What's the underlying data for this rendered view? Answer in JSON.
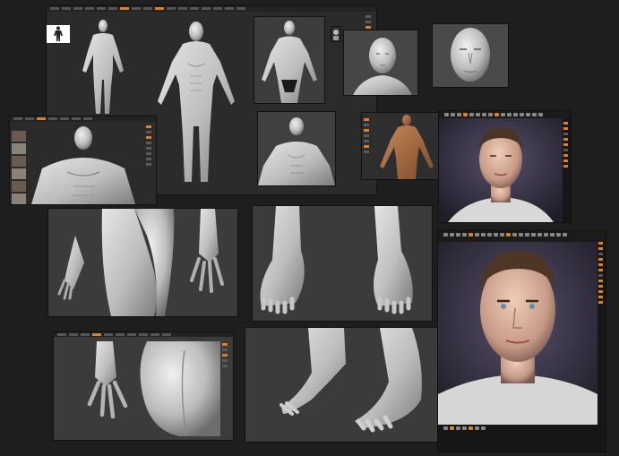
{
  "colors": {
    "background": "#1e1e1e",
    "viewport": "#3a3a3a",
    "ui_dark": "#232323",
    "accent": "#d8802a",
    "clay_light": "#d9d9d9",
    "clay_shadow": "#7a7a7a",
    "skin": "#c9a08a",
    "skin_bronze": "#a06a45"
  },
  "icons": {
    "figure_thumbnail": "human-silhouette-icon",
    "toolbar_buttons": "toolbar-button-icon",
    "side_tools": "tool-button-icon"
  },
  "panels": [
    {
      "name": "main-viewport-fullbody",
      "content": "sculpt"
    },
    {
      "name": "bust-closeup",
      "content": "sculpt"
    },
    {
      "name": "face-closeup",
      "content": "sculpt"
    },
    {
      "name": "torso-viewport",
      "content": "sculpt"
    },
    {
      "name": "bronze-figure",
      "content": "sculpt"
    },
    {
      "name": "render-face-1",
      "content": "render"
    },
    {
      "name": "render-face-2",
      "content": "render"
    },
    {
      "name": "hip-hands",
      "content": "sculpt"
    },
    {
      "name": "feet-front",
      "content": "sculpt"
    },
    {
      "name": "glutes-hand",
      "content": "sculpt"
    },
    {
      "name": "feet-side",
      "content": "sculpt"
    }
  ]
}
